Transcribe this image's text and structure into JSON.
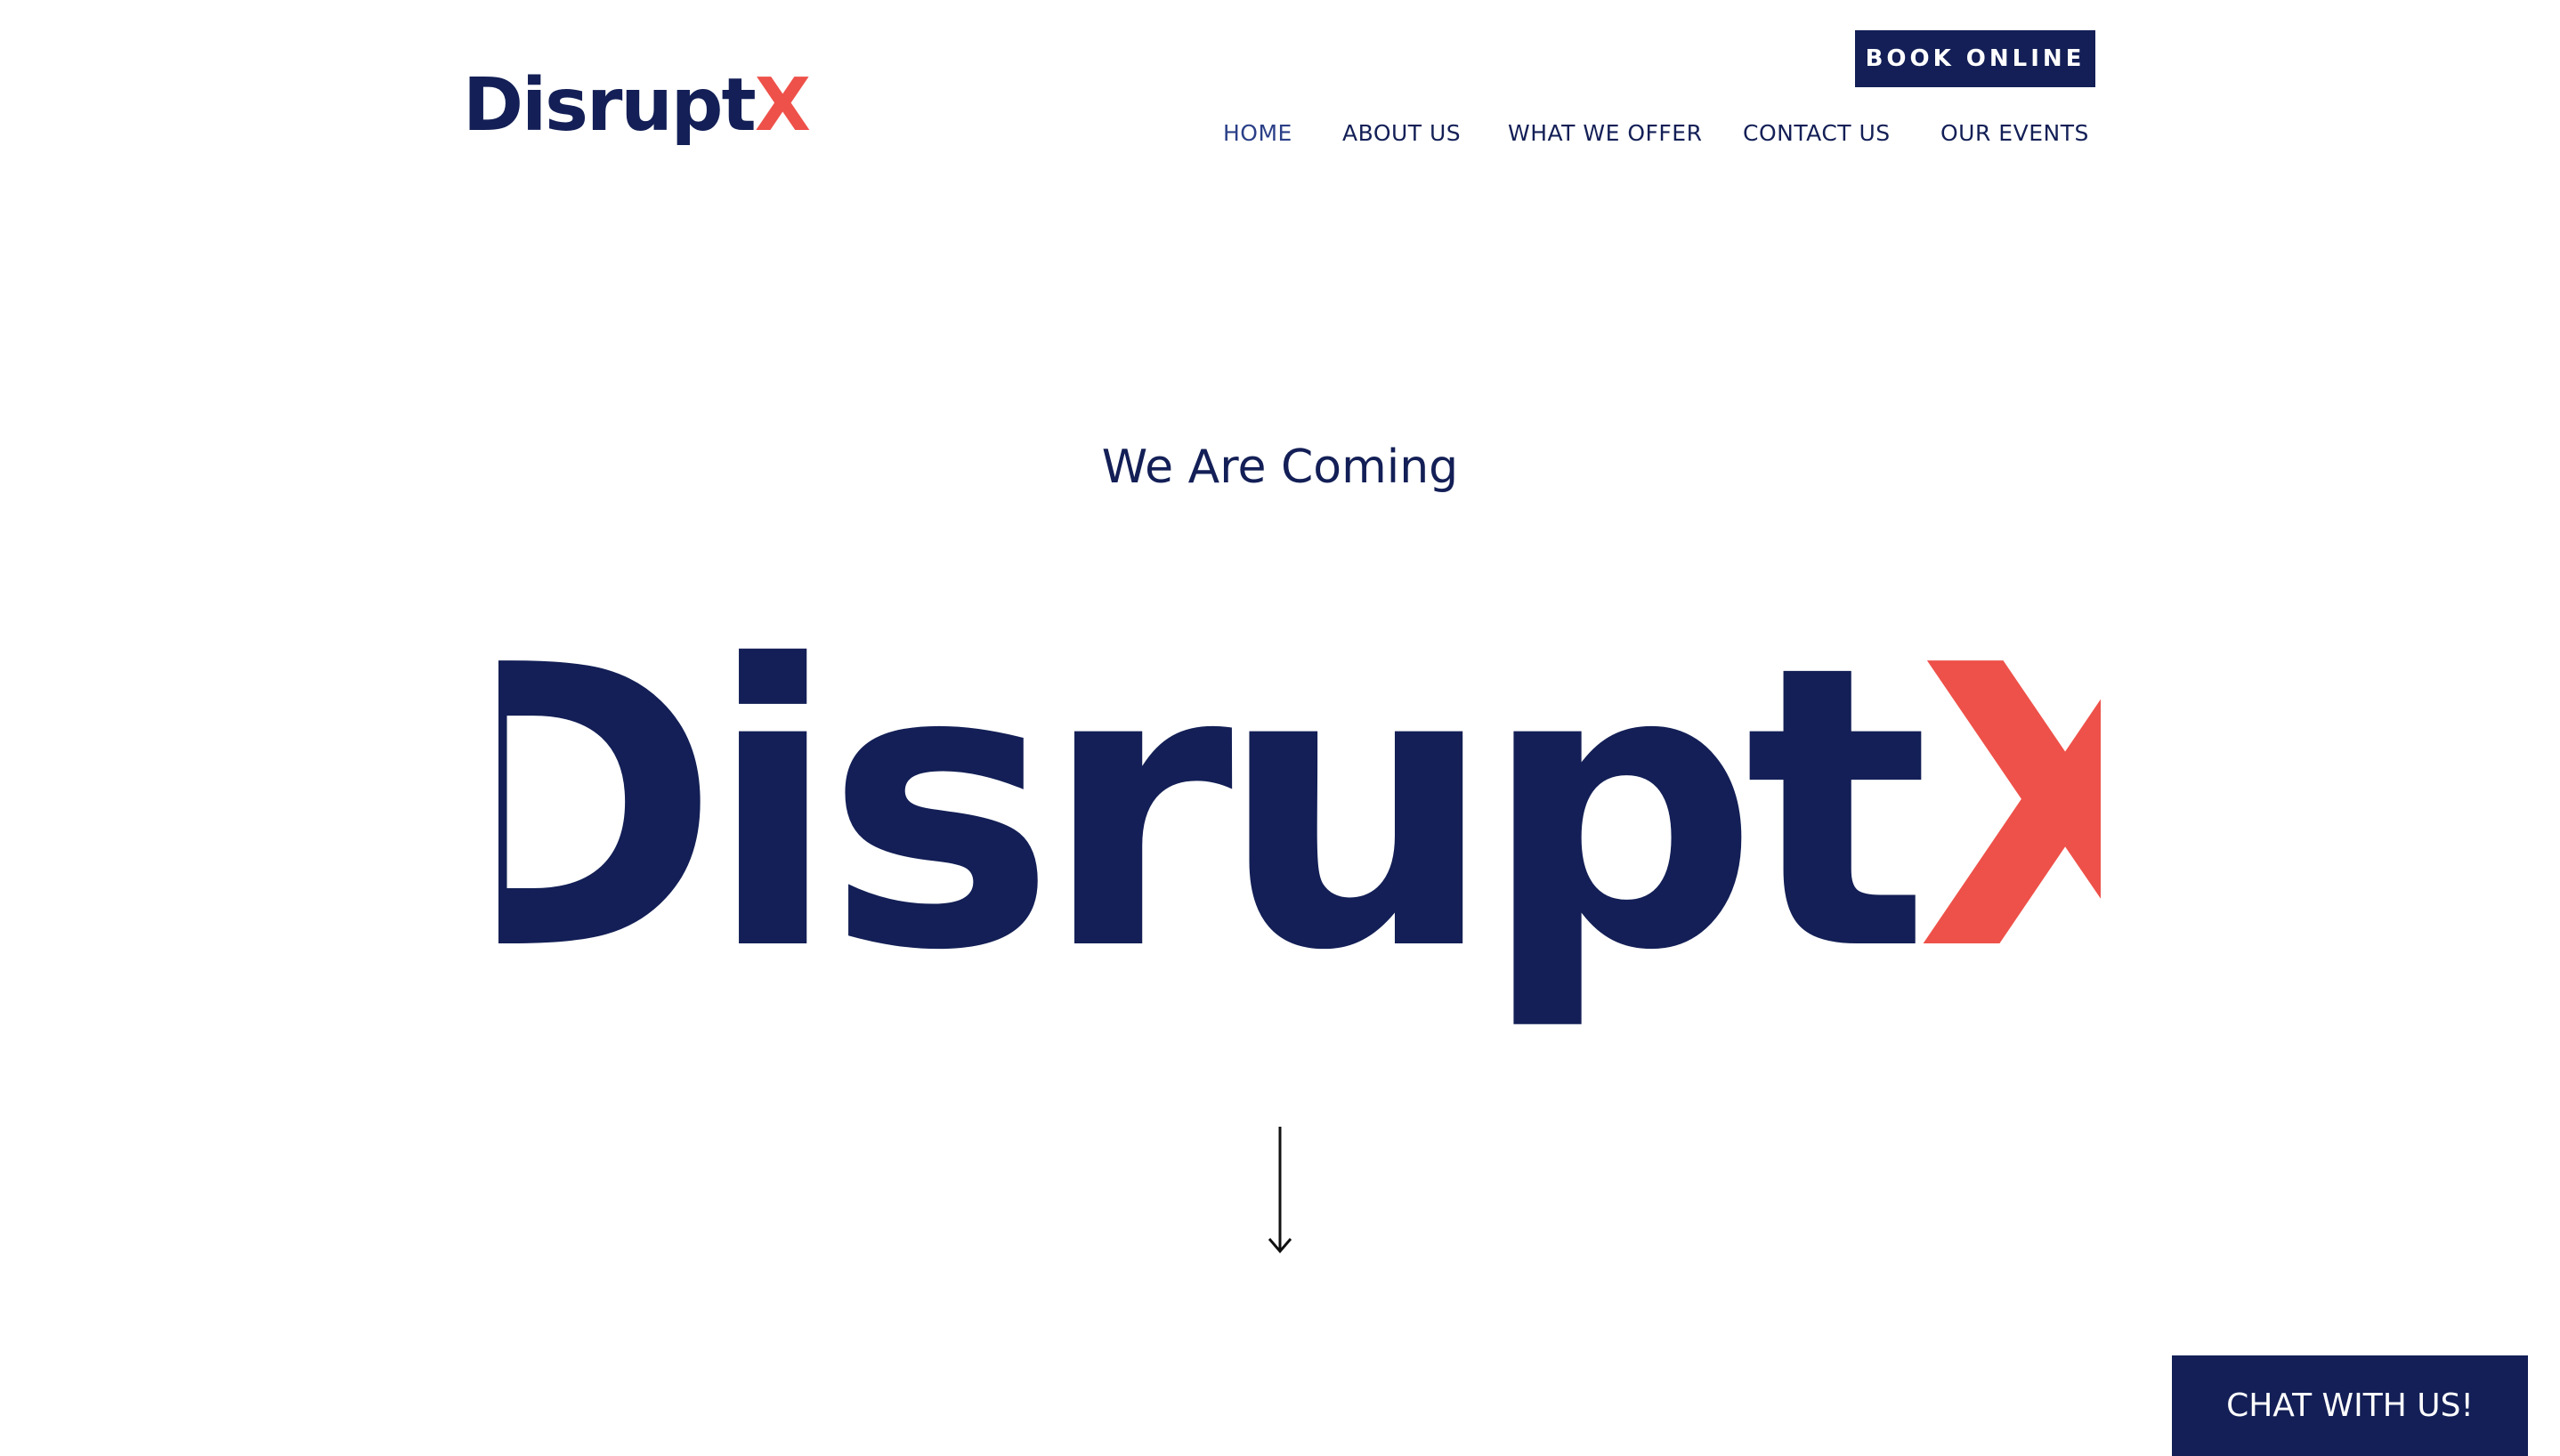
{
  "brand": {
    "name_main": "Disrupt",
    "name_accent": "X",
    "colors": {
      "primary": "#131f56",
      "accent": "#ee5149",
      "background": "#ffffff"
    }
  },
  "header": {
    "book_button_label": "BOOK ONLINE",
    "nav": [
      {
        "label": "HOME",
        "active": true
      },
      {
        "label": "ABOUT US",
        "active": false
      },
      {
        "label": "WHAT WE OFFER",
        "active": false
      },
      {
        "label": "CONTACT US",
        "active": false
      },
      {
        "label": "OUR EVENTS",
        "active": false
      }
    ]
  },
  "hero": {
    "tagline": "We Are Coming",
    "title_main": "Disrupt",
    "title_accent": "X",
    "scroll_icon": "arrow-down-icon"
  },
  "chat": {
    "label": "CHAT WITH US!"
  }
}
